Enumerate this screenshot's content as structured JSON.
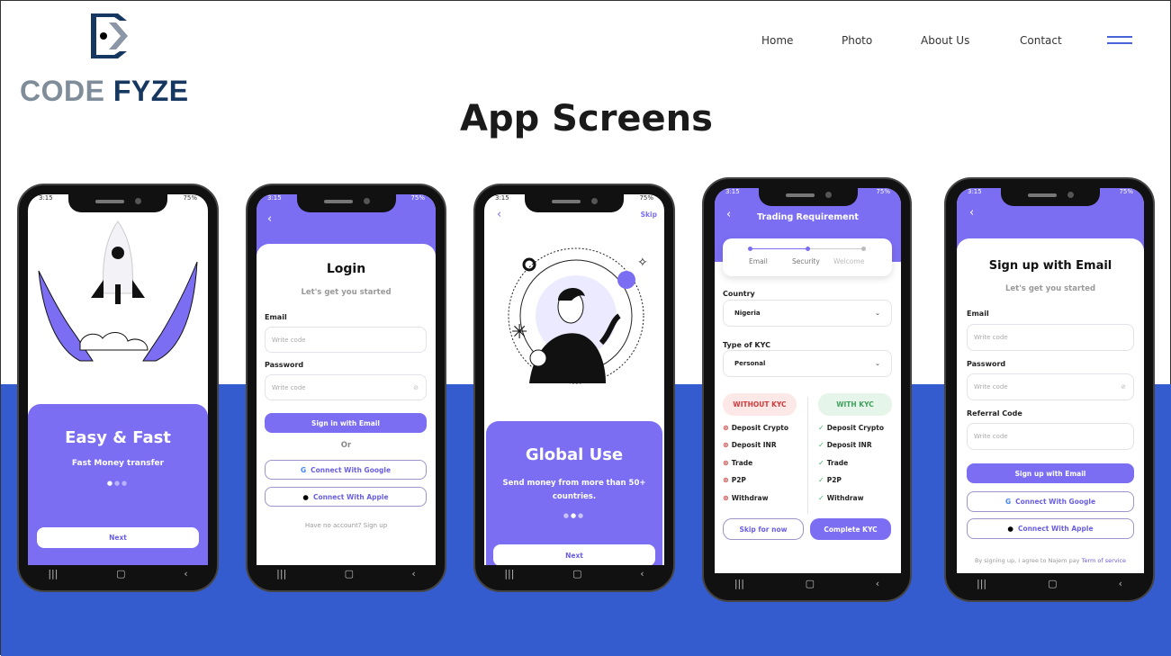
{
  "brand": {
    "part1": "CODE",
    "part2": "FYZE"
  },
  "nav": {
    "items": [
      "Home",
      "Photo",
      "About Us",
      "Contact"
    ]
  },
  "page_title": "App Screens",
  "colors": {
    "accent": "#7b6ef2",
    "band": "#355ccf",
    "logo_dark": "#16375f",
    "logo_gray": "#7f8c99"
  },
  "status": {
    "time": "3:15",
    "battery": "75%"
  },
  "screen1": {
    "title": "Easy & Fast",
    "subtitle": "Fast Money transfer",
    "next": "Next"
  },
  "screen2": {
    "title": "Login",
    "subtitle": "Let's get you started",
    "email_label": "Email",
    "email_placeholder": "Write code",
    "password_label": "Password",
    "password_placeholder": "Write code",
    "signin": "Sign in with Email",
    "or": "Or",
    "google": "Connect With Google",
    "apple": "Connect With Apple",
    "footer": "Have no account? Sign up"
  },
  "screen3": {
    "skip": "Skip",
    "title": "Global Use",
    "text": "Send money from more than 50+ countries.",
    "next": "Next"
  },
  "screen4": {
    "title": "Trading Requirement",
    "steps": [
      "Email",
      "Security",
      "Welcome"
    ],
    "country_label": "Country",
    "country": "Nigeria",
    "kyc_type_label": "Type of KYC",
    "kyc_type": "Personal",
    "without_kyc": "WITHOUT KYC",
    "with_kyc": "WITH KYC",
    "features": [
      "Deposit Crypto",
      "Deposit  INR",
      "Trade",
      "P2P",
      "Withdraw"
    ],
    "skip": "Skip for now",
    "complete": "Complete KYC"
  },
  "screen5": {
    "title": "Sign up with Email",
    "subtitle": "Let's get you started",
    "email_label": "Email",
    "email_placeholder": "Write code",
    "password_label": "Password",
    "password_placeholder": "Write code",
    "referral_label": "Referral Code",
    "referral_placeholder": "Write code",
    "signup": "Sign up with Email",
    "google": "Connect With Google",
    "apple": "Connect With Apple",
    "footer": "By signing up, I agree to Najem pay",
    "footer_link": "Term of service"
  }
}
